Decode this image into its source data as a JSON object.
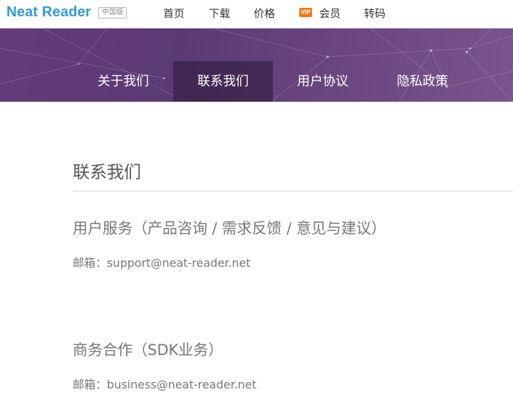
{
  "header": {
    "logo": "Neat Reader",
    "edition_badge": "中国版",
    "nav": [
      {
        "label": "首页"
      },
      {
        "label": "下载"
      },
      {
        "label": "价格"
      },
      {
        "label": "会员",
        "icon": "vip-icon",
        "icon_text": "VIP"
      },
      {
        "label": "转码"
      }
    ]
  },
  "banner": {
    "tabs": [
      {
        "label": "关于我们",
        "active": false
      },
      {
        "label": "联系我们",
        "active": true
      },
      {
        "label": "用户协议",
        "active": false
      },
      {
        "label": "隐私政策",
        "active": false
      }
    ]
  },
  "main": {
    "title": "联系我们",
    "sections": [
      {
        "heading": "用户服务（产品咨询 / 需求反馈 / 意见与建议）",
        "email_label": "邮箱：",
        "email": "support@neat-reader.net"
      },
      {
        "heading": "商务合作（SDK业务）",
        "email_label": "邮箱：",
        "email": "business@neat-reader.net"
      }
    ]
  },
  "colors": {
    "logo": "#3399dd",
    "vip_badge": "#f5740f",
    "banner": "#5b3a74"
  }
}
